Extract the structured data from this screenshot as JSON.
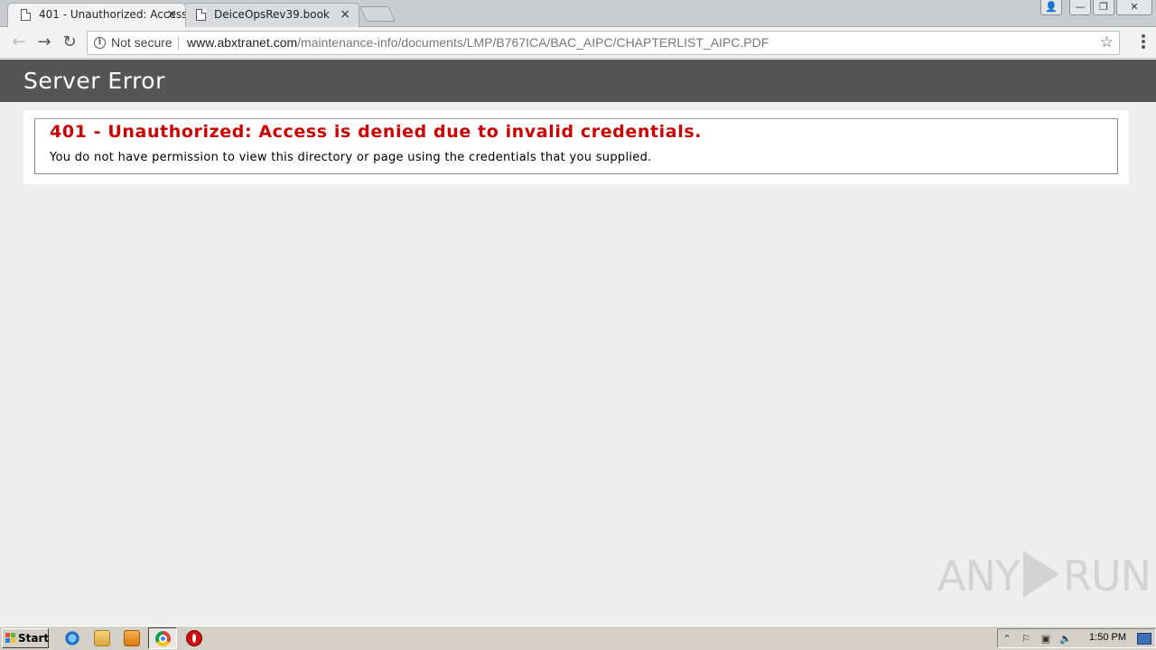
{
  "browser": {
    "tabs": [
      {
        "title": "401 - Unauthorized: Access",
        "active": true
      },
      {
        "title": "DeiceOpsRev39.book",
        "active": false
      }
    ],
    "tab_close_glyph": "×",
    "window_buttons": {
      "user": "👤",
      "minimize": "—",
      "restore": "❐",
      "close": "✕"
    },
    "nav": {
      "back": "←",
      "forward": "→",
      "reload": "↻"
    },
    "security_label": "Not secure",
    "url_host": "www.abxtranet.com",
    "url_path": "/maintenance-info/documents/LMP/B767ICA/BAC_AIPC/CHAPTERLIST_AIPC.PDF",
    "bookmark_glyph": "☆"
  },
  "page": {
    "header_title": "Server Error",
    "error_heading": "401 - Unauthorized: Access is denied due to invalid credentials.",
    "error_description": "You do not have permission to view this directory or page using the credentials that you supplied."
  },
  "watermark": {
    "left": "ANY",
    "right": "RUN"
  },
  "taskbar": {
    "start_label": "Start",
    "clock": "1:50 PM",
    "tray_glyphs": {
      "expand": "⌃",
      "flag": "⚐",
      "network": "▣",
      "volume": "🔈"
    }
  },
  "colors": {
    "header_bg": "#555555",
    "error_red": "#cc0000",
    "page_bg": "#eeeeee"
  }
}
